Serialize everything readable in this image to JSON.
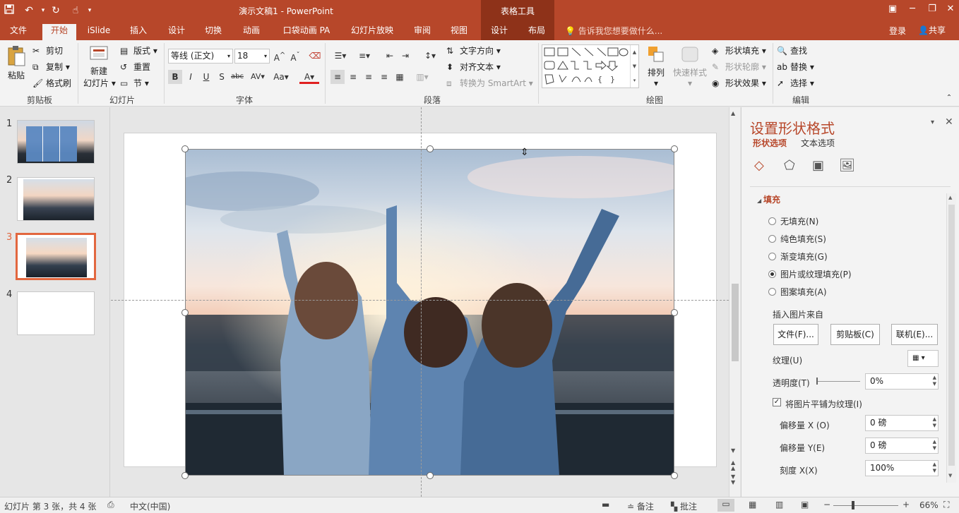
{
  "title_bar": {
    "doc_title": "演示文稿1 - PowerPoint",
    "context_tools": "表格工具",
    "qa_icons": [
      "save-icon",
      "undo-icon",
      "redo-icon",
      "touch-mode-icon"
    ]
  },
  "tabs": [
    "文件",
    "开始",
    "iSlide",
    "插入",
    "设计",
    "切换",
    "动画",
    "口袋动画 PA",
    "幻灯片放映",
    "审阅",
    "视图",
    "设计",
    "布局"
  ],
  "active_tab": "开始",
  "tell_me": "告诉我您想要做什么...",
  "login": "登录",
  "share": "共享",
  "ribbon": {
    "clipboard": {
      "paste": "粘贴",
      "cut": "剪切",
      "copy": "复制",
      "format_painter": "格式刷",
      "label": "剪贴板"
    },
    "slides": {
      "new_slide": "新建",
      "new_slide2": "幻灯片",
      "layout": "版式",
      "reset": "重置",
      "section": "节",
      "label": "幻灯片"
    },
    "font": {
      "font_name": "等线 (正文)",
      "font_size": "18",
      "label": "字体",
      "bold": "B",
      "italic": "I",
      "underline": "U",
      "shadow": "S",
      "strike": "abc",
      "spacing": "AV",
      "case": "Aa",
      "color": "A"
    },
    "paragraph": {
      "text_direction": "文字方向",
      "align_text": "对齐文本",
      "smartart": "转换为 SmartArt",
      "label": "段落"
    },
    "drawing": {
      "arrange": "排列",
      "quick_styles": "快速样式",
      "shape_fill": "形状填充",
      "shape_outline": "形状轮廓",
      "shape_effects": "形状效果",
      "label": "绘图"
    },
    "editing": {
      "find": "查找",
      "replace": "替换",
      "select": "选择",
      "label": "编辑"
    }
  },
  "slides": [
    {
      "num": "1"
    },
    {
      "num": "2"
    },
    {
      "num": "3"
    },
    {
      "num": "4"
    }
  ],
  "selected_slide": "3",
  "format_pane": {
    "title": "设置形状格式",
    "tab_shape": "形状选项",
    "tab_text": "文本选项",
    "section": "填充",
    "options": [
      "无填充(N)",
      "纯色填充(S)",
      "渐变填充(G)",
      "图片或纹理填充(P)",
      "图案填充(A)"
    ],
    "selected_option": "图片或纹理填充(P)",
    "insert_from": "插入图片来自",
    "btn_file": "文件(F)...",
    "btn_clipboard": "剪贴板(C)",
    "btn_online": "联机(E)...",
    "texture": "纹理(U)",
    "transparency": "透明度(T)",
    "transparency_value": "0%",
    "tile": "将图片平铺为纹理(I)",
    "offset_x": "偏移量 X (O)",
    "offset_x_value": "0 磅",
    "offset_y": "偏移量 Y(E)",
    "offset_y_value": "0 磅",
    "scale_x": "刻度 X(X)",
    "scale_x_value": "100%"
  },
  "status": {
    "slide_info": "幻灯片 第 3 张，共 4 张",
    "language": "中文(中国)",
    "notes": "备注",
    "comments": "批注",
    "zoom": "66%"
  }
}
